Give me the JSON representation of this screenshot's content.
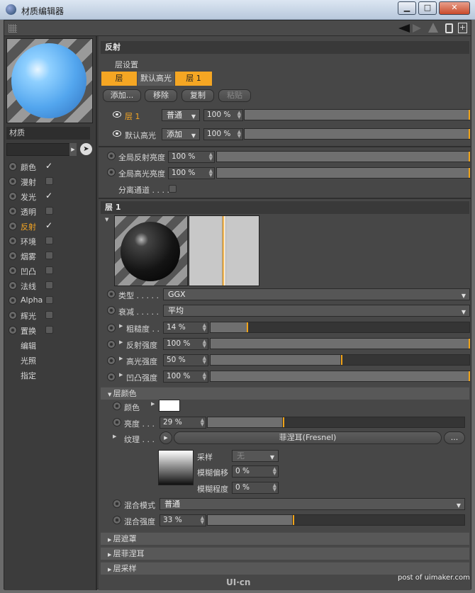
{
  "window": {
    "title": "材质编辑器",
    "minimize": "▁",
    "maximize": "□",
    "close": "✕"
  },
  "left": {
    "material_name": "材质",
    "channels": [
      {
        "label": "颜色",
        "checked": true,
        "active": false
      },
      {
        "label": "漫射",
        "checked": false,
        "active": false
      },
      {
        "label": "发光",
        "checked": true,
        "active": false
      },
      {
        "label": "透明",
        "checked": false,
        "active": false
      },
      {
        "label": "反射",
        "checked": true,
        "active": true
      },
      {
        "label": "环境",
        "checked": false,
        "active": false
      },
      {
        "label": "烟雾",
        "checked": false,
        "active": false
      },
      {
        "label": "凹凸",
        "checked": false,
        "active": false
      },
      {
        "label": "法线",
        "checked": false,
        "active": false
      },
      {
        "label": "Alpha",
        "checked": false,
        "active": false
      },
      {
        "label": "辉光",
        "checked": false,
        "active": false
      },
      {
        "label": "置换",
        "checked": false,
        "active": false
      }
    ],
    "extras": [
      "编辑",
      "光照",
      "指定"
    ]
  },
  "reflect": {
    "title": "反射",
    "layer_settings": "层设置",
    "tabs": [
      "层",
      "默认高光",
      "层 1"
    ],
    "buttons": {
      "add": "添加...",
      "remove": "移除",
      "copy": "复制",
      "paste": "粘贴"
    },
    "layers": [
      {
        "name": "层 1",
        "mode": "普通",
        "value": "100 %",
        "fraction": 1.0
      },
      {
        "name": "默认高光",
        "mode": "添加",
        "value": "100 %",
        "fraction": 1.0
      }
    ],
    "global_reflect_label": "全局反射亮度",
    "global_reflect_value": "100 %",
    "global_spec_label": "全局高光亮度",
    "global_spec_value": "100 %",
    "separate_label": "分离通道 . . . ."
  },
  "layer1": {
    "title": "层 1",
    "type_label": "类型 . . . . .",
    "type_value": "GGX",
    "atten_label": "衰减 . . . . .",
    "atten_value": "平均",
    "params": [
      {
        "label": "粗糙度 . .",
        "value": "14 %",
        "fraction": 0.14
      },
      {
        "label": "反射强度",
        "value": "100 %",
        "fraction": 1.0
      },
      {
        "label": "高光强度",
        "value": "50 %",
        "fraction": 0.5
      },
      {
        "label": "凹凸强度",
        "value": "100 %",
        "fraction": 1.0
      }
    ],
    "color_section": "层颜色",
    "color_label": "颜色",
    "color_value": "#ffffff",
    "brightness_label": "亮度 . . .",
    "brightness_value": "29 %",
    "brightness_fraction": 0.29,
    "texture_label": "纹理 . . .",
    "texture_value": "菲涅耳(Fresnel)",
    "texture_more": "...",
    "sample_label": "采样",
    "sample_value": "无",
    "blur_offset_label": "模糊偏移",
    "blur_offset_value": "0 %",
    "blur_amount_label": "模糊程度",
    "blur_amount_value": "0 %",
    "blend_mode_label": "混合模式",
    "blend_mode_value": "普通",
    "blend_strength_label": "混合强度",
    "blend_strength_value": "33 %",
    "blend_fraction": 0.33,
    "collapsed": [
      "层遮罩",
      "层菲涅耳",
      "层采样"
    ]
  },
  "watermark": {
    "logo": "UI·cn",
    "credit": "post of uimaker.com"
  },
  "colors": {
    "accent": "#f5a623",
    "background": "#474747"
  }
}
